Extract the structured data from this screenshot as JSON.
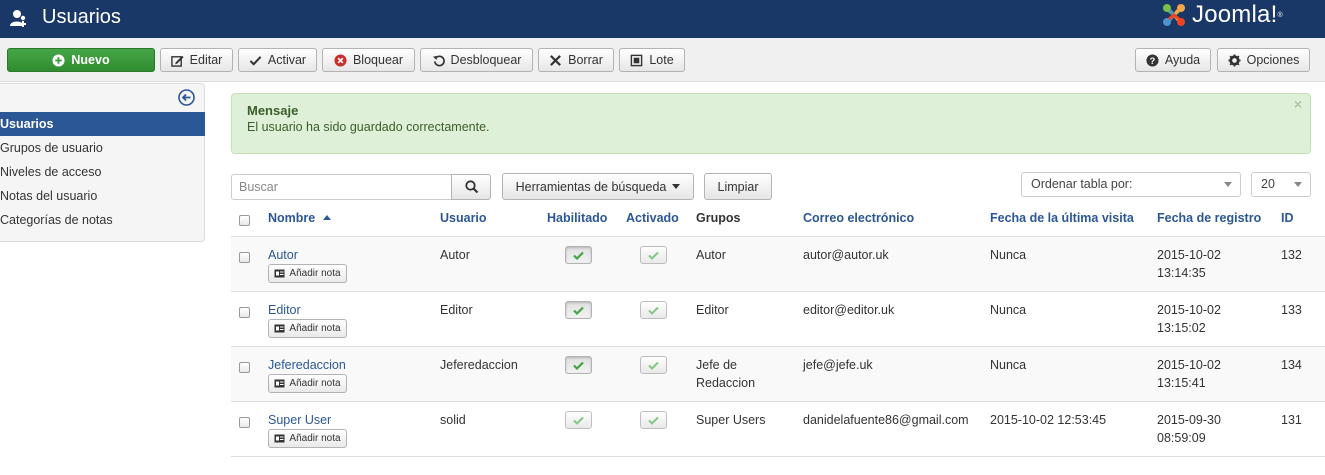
{
  "header": {
    "title": "Usuarios",
    "logo_text": "Joomla!",
    "logo_mark": "®"
  },
  "toolbar": {
    "new": "Nuevo",
    "edit": "Editar",
    "activate": "Activar",
    "block": "Bloquear",
    "unblock": "Desbloquear",
    "delete": "Borrar",
    "batch": "Lote",
    "help": "Ayuda",
    "options": "Opciones"
  },
  "sidebar": {
    "items": [
      {
        "label": "Usuarios",
        "active": true
      },
      {
        "label": "Grupos de usuario"
      },
      {
        "label": "Niveles de acceso"
      },
      {
        "label": "Notas del usuario"
      },
      {
        "label": "Categorías de notas"
      }
    ]
  },
  "alert": {
    "heading": "Mensaje",
    "message": "El usuario ha sido guardado correctamente.",
    "close": "×"
  },
  "search": {
    "placeholder": "Buscar",
    "tools_label": "Herramientas de búsqueda",
    "clear_label": "Limpiar",
    "sort_label": "Ordenar tabla por:",
    "limit_value": "20"
  },
  "table": {
    "headers": {
      "name": "Nombre",
      "username": "Usuario",
      "enabled": "Habilitado",
      "activated": "Activado",
      "groups": "Grupos",
      "email": "Correo electrónico",
      "last_visit": "Fecha de la última visita",
      "registered": "Fecha de registro",
      "id": "ID"
    },
    "note_label": "Añadir nota",
    "rows": [
      {
        "name": "Autor",
        "username": "Autor",
        "groups_1": "Autor",
        "groups_2": "",
        "email": "autor@autor.uk",
        "last_visit": "Nunca",
        "reg_date": "2015-10-02",
        "reg_time": "13:14:35",
        "id": "132",
        "enabled": true,
        "activated": true
      },
      {
        "name": "Editor",
        "username": "Editor",
        "groups_1": "Editor",
        "groups_2": "",
        "email": "editor@editor.uk",
        "last_visit": "Nunca",
        "reg_date": "2015-10-02",
        "reg_time": "13:15:02",
        "id": "133",
        "enabled": true,
        "activated": true
      },
      {
        "name": "Jeferedaccion",
        "username": "Jeferedaccion",
        "groups_1": "Jefe de",
        "groups_2": "Redaccion",
        "email": "jefe@jefe.uk",
        "last_visit": "Nunca",
        "reg_date": "2015-10-02",
        "reg_time": "13:15:41",
        "id": "134",
        "enabled": true,
        "activated": true
      },
      {
        "name": "Super User",
        "username": "solid",
        "groups_1": "Super Users",
        "groups_2": "",
        "email": "danidelafuente86@gmail.com",
        "last_visit": "2015-10-02 12:53:45",
        "reg_date": "2015-09-30",
        "reg_time": "08:59:09",
        "id": "131",
        "enabled": true,
        "activated": true
      }
    ]
  },
  "colors": {
    "header_bg": "#1a3867",
    "accent": "#2b5796",
    "success_bg": "#dff0d8",
    "new_button": "#3c9a3c",
    "check_green": "#46a546"
  }
}
